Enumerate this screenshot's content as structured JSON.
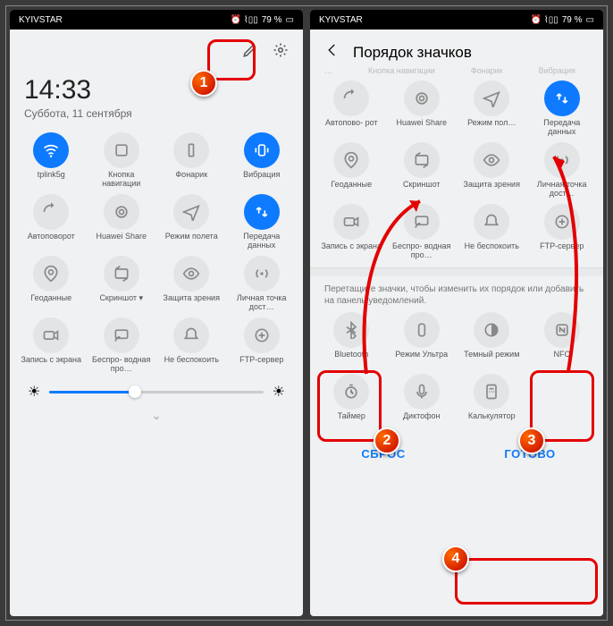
{
  "status": {
    "carrier": "KYIVSTAR",
    "battery": "79 %",
    "icons": "⏰ ⌇▯▯"
  },
  "left": {
    "time": "14:33",
    "date": "Суббота, 11 сентября",
    "tiles": [
      {
        "label": "tplink5g",
        "active": true,
        "icon": "wifi"
      },
      {
        "label": "Кнопка навигации",
        "active": false,
        "icon": "nav"
      },
      {
        "label": "Фонарик",
        "active": false,
        "icon": "torch"
      },
      {
        "label": "Вибрация",
        "active": true,
        "icon": "vibrate"
      },
      {
        "label": "Автоповорот",
        "active": false,
        "icon": "rotate"
      },
      {
        "label": "Huawei Share",
        "active": false,
        "icon": "share"
      },
      {
        "label": "Режим полета",
        "active": false,
        "icon": "plane"
      },
      {
        "label": "Передача данных",
        "active": true,
        "icon": "data"
      },
      {
        "label": "Геоданные",
        "active": false,
        "icon": "geo"
      },
      {
        "label": "Скриншот ▾",
        "active": false,
        "icon": "shot"
      },
      {
        "label": "Защита зрения",
        "active": false,
        "icon": "eye"
      },
      {
        "label": "Личная точка дост…",
        "active": false,
        "icon": "hotspot"
      },
      {
        "label": "Запись с экрана",
        "active": false,
        "icon": "rec"
      },
      {
        "label": "Беспро- водная про…",
        "active": false,
        "icon": "cast"
      },
      {
        "label": "Не беспокоить",
        "active": false,
        "icon": "dnd"
      },
      {
        "label": "FTP-сервер",
        "active": false,
        "icon": "ftp"
      }
    ]
  },
  "right": {
    "title": "Порядок значков",
    "toprow_labels": [
      "…",
      "Кнопка навигации",
      "Фонарик",
      "Вибрация"
    ],
    "tiles1": [
      {
        "label": "Автопово- рот",
        "icon": "rotate"
      },
      {
        "label": "Huawei Share",
        "icon": "share"
      },
      {
        "label": "Режим пол…",
        "icon": "plane"
      },
      {
        "label": "Передача данных",
        "icon": "data",
        "active": true
      },
      {
        "label": "Геоданные",
        "icon": "geo"
      },
      {
        "label": "Скриншот",
        "icon": "shot"
      },
      {
        "label": "Защита зрения",
        "icon": "eye"
      },
      {
        "label": "Личная точка дост…",
        "icon": "hotspot"
      },
      {
        "label": "Запись с экрана",
        "icon": "rec"
      },
      {
        "label": "Беспро- водная про…",
        "icon": "cast"
      },
      {
        "label": "Не беспокоить",
        "icon": "dnd"
      },
      {
        "label": "FTP-сервер",
        "icon": "ftp"
      }
    ],
    "hint": "Перетащите значки, чтобы изменить их порядок или добавить на панель уведомлений.",
    "tiles2": [
      {
        "label": "Bluetooth",
        "icon": "bt"
      },
      {
        "label": "Режим Ультра",
        "icon": "ultra"
      },
      {
        "label": "Темный режим",
        "icon": "dark"
      },
      {
        "label": "NFC",
        "icon": "nfc"
      },
      {
        "label": "Таймер",
        "icon": "timer"
      },
      {
        "label": "Диктофон",
        "icon": "mic"
      },
      {
        "label": "Калькулятор",
        "icon": "calc"
      }
    ],
    "reset": "СБРОС",
    "done": "ГОТОВО"
  },
  "badges": {
    "b1": "1",
    "b2": "2",
    "b3": "3",
    "b4": "4"
  }
}
